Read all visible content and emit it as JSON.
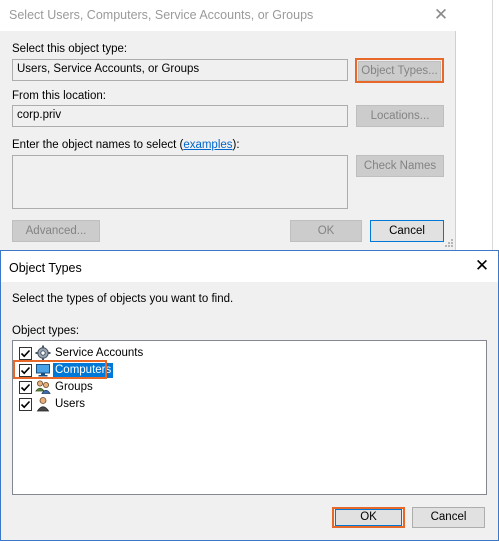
{
  "background_dialog": {
    "title": "Select Users, Computers, Service Accounts, or Groups",
    "close_glyph": "✕",
    "object_type_label": "Select this object type:",
    "object_type_value": "Users, Service Accounts, or Groups",
    "object_types_button": "Object Types...",
    "location_label": "From this location:",
    "location_value": "corp.priv",
    "locations_button": "Locations...",
    "names_label_prefix": "Enter the object names to select (",
    "names_label_link": "examples",
    "names_label_suffix": "):",
    "check_names_button": "Check Names",
    "advanced_button": "Advanced...",
    "ok_button": "OK",
    "cancel_button": "Cancel"
  },
  "object_types_dialog": {
    "title": "Object Types",
    "close_glyph": "✕",
    "instruction": "Select the types of objects you want to find.",
    "list_label": "Object types:",
    "items": [
      {
        "label": "Service Accounts",
        "checked": true,
        "icon": "service-accounts-icon",
        "selected": false
      },
      {
        "label": "Computers",
        "checked": true,
        "icon": "computers-icon",
        "selected": true
      },
      {
        "label": "Groups",
        "checked": true,
        "icon": "groups-icon",
        "selected": false
      },
      {
        "label": "Users",
        "checked": true,
        "icon": "users-icon",
        "selected": false
      }
    ],
    "ok_button": "OK",
    "cancel_button": "Cancel"
  },
  "colors": {
    "highlight": "#e8682a",
    "selection": "#0078d7",
    "link": "#0066cc"
  }
}
